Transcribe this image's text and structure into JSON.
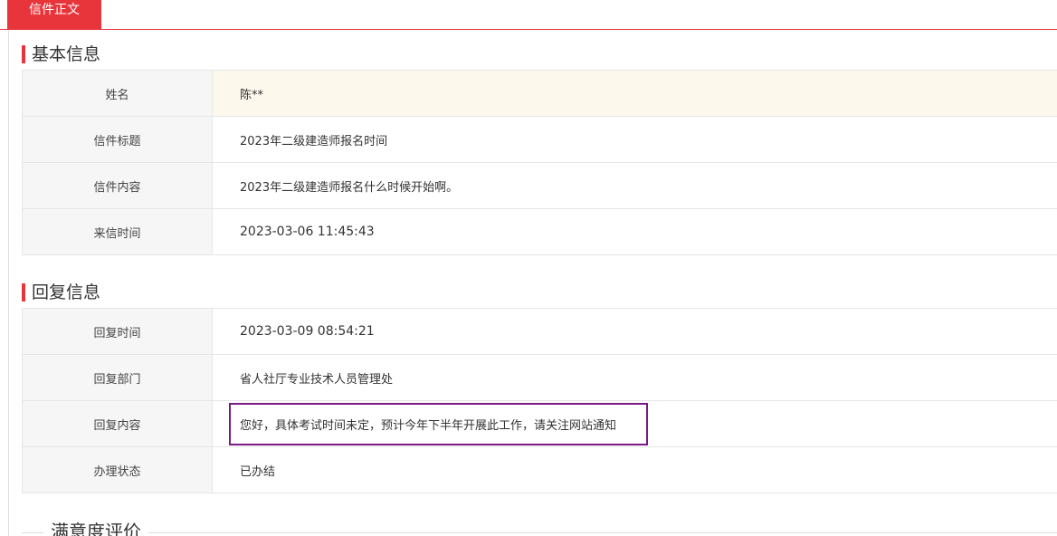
{
  "tab": {
    "label": "信件正文"
  },
  "basic_info": {
    "title": "基本信息",
    "rows": [
      {
        "label": "姓名",
        "value": "陈**"
      },
      {
        "label": "信件标题",
        "value": "2023年二级建造师报名时间"
      },
      {
        "label": "信件内容",
        "value": "2023年二级建造师报名什么时候开始啊。"
      },
      {
        "label": "来信时间",
        "value": "2023-03-06 11:45:43"
      }
    ]
  },
  "reply_info": {
    "title": "回复信息",
    "rows": [
      {
        "label": "回复时间",
        "value": "2023-03-09 08:54:21"
      },
      {
        "label": "回复部门",
        "value": "省人社厅专业技术人员管理处"
      },
      {
        "label": "回复内容",
        "value": "您好，具体考试时间未定，预计今年下半年开展此工作，请关注网站通知"
      },
      {
        "label": "办理状态",
        "value": "已办结"
      }
    ]
  },
  "evaluation": {
    "title": "满意度评价"
  },
  "colors": {
    "accent": "#e8353b",
    "highlight_box": "#7b1a85",
    "row_highlight": "#fdf8ec"
  }
}
